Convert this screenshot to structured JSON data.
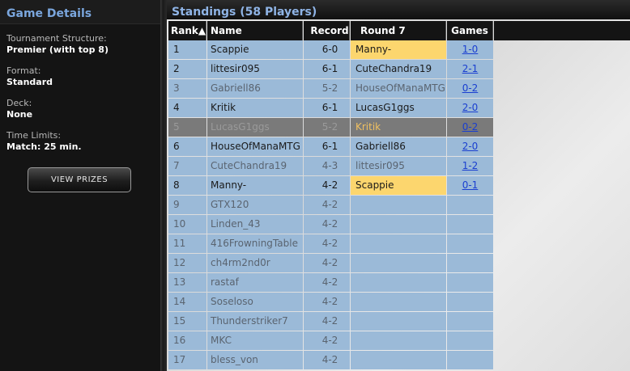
{
  "game_details": {
    "title": "Game Details",
    "structure_label": "Tournament Structure:",
    "structure_value": "Premier (with top 8)",
    "format_label": "Format:",
    "format_value": "Standard",
    "deck_label": "Deck:",
    "deck_value": "None",
    "time_label": "Time Limits:",
    "time_value": "Match: 25 min.",
    "prizes_button": "VIEW PRIZES"
  },
  "standings": {
    "title": "Standings (58 Players)",
    "columns": {
      "rank": "Rank▲",
      "name": "Name",
      "record": "Record",
      "round": "Round 7",
      "games": "Games"
    },
    "rows": [
      {
        "rank": "1",
        "name": "Scappie",
        "record": "6-0",
        "opponent": "Manny-",
        "games": "1-0"
      },
      {
        "rank": "2",
        "name": "littesir095",
        "record": "6-1",
        "opponent": "CuteChandra19",
        "games": "2-1"
      },
      {
        "rank": "3",
        "name": "Gabriell86",
        "record": "5-2",
        "opponent": "HouseOfManaMTG",
        "games": "0-2"
      },
      {
        "rank": "4",
        "name": "Kritik",
        "record": "6-1",
        "opponent": "LucasG1ggs",
        "games": "2-0"
      },
      {
        "rank": "5",
        "name": "LucasG1ggs",
        "record": "5-2",
        "opponent": "Kritik",
        "games": "0-2"
      },
      {
        "rank": "6",
        "name": "HouseOfManaMTG",
        "record": "6-1",
        "opponent": "Gabriell86",
        "games": "2-0"
      },
      {
        "rank": "7",
        "name": "CuteChandra19",
        "record": "4-3",
        "opponent": "littesir095",
        "games": "1-2"
      },
      {
        "rank": "8",
        "name": "Manny-",
        "record": "4-2",
        "opponent": "Scappie",
        "games": "0-1"
      },
      {
        "rank": "9",
        "name": "GTX120",
        "record": "4-2",
        "opponent": "",
        "games": ""
      },
      {
        "rank": "10",
        "name": "Linden_43",
        "record": "4-2",
        "opponent": "",
        "games": ""
      },
      {
        "rank": "11",
        "name": "416FrowningTable",
        "record": "4-2",
        "opponent": "",
        "games": ""
      },
      {
        "rank": "12",
        "name": "ch4rm2nd0r",
        "record": "4-2",
        "opponent": "",
        "games": ""
      },
      {
        "rank": "13",
        "name": "rastaf",
        "record": "4-2",
        "opponent": "",
        "games": ""
      },
      {
        "rank": "14",
        "name": "Soseloso",
        "record": "4-2",
        "opponent": "",
        "games": ""
      },
      {
        "rank": "15",
        "name": "Thunderstriker7",
        "record": "4-2",
        "opponent": "",
        "games": ""
      },
      {
        "rank": "16",
        "name": "MKC",
        "record": "4-2",
        "opponent": "",
        "games": ""
      },
      {
        "rank": "17",
        "name": "bless_von",
        "record": "4-2",
        "opponent": "",
        "games": ""
      }
    ]
  }
}
